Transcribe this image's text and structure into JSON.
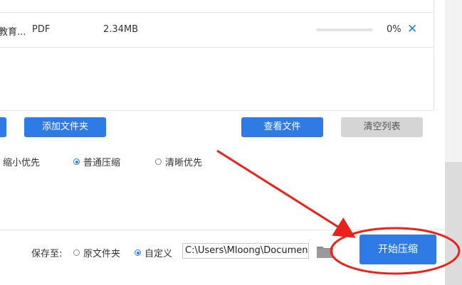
{
  "file_row": {
    "name": "教育...",
    "type": "PDF",
    "size": "2.34MB",
    "progress_percent": 0,
    "progress_text": "0%",
    "remove_glyph": "✕"
  },
  "actions": {
    "add_folder": "添加文件夹",
    "view_files": "查看文件",
    "clear_list": "清空列表"
  },
  "compression_mode": {
    "options": [
      "缩小优先",
      "普通压缩",
      "清晰优先"
    ],
    "selected": "普通压缩"
  },
  "save": {
    "label": "保存至:",
    "options": [
      "原文件夹",
      "自定义"
    ],
    "selected": "自定义",
    "path_value": "C:\\Users\\Mloong\\Documents"
  },
  "start_button": {
    "label": "开始压缩"
  },
  "colors": {
    "primary": "#2f7be6",
    "annotation": "#e8231c"
  },
  "icons": [
    "close-icon",
    "folder-icon",
    "arrow-annotation",
    "circle-annotation"
  ]
}
